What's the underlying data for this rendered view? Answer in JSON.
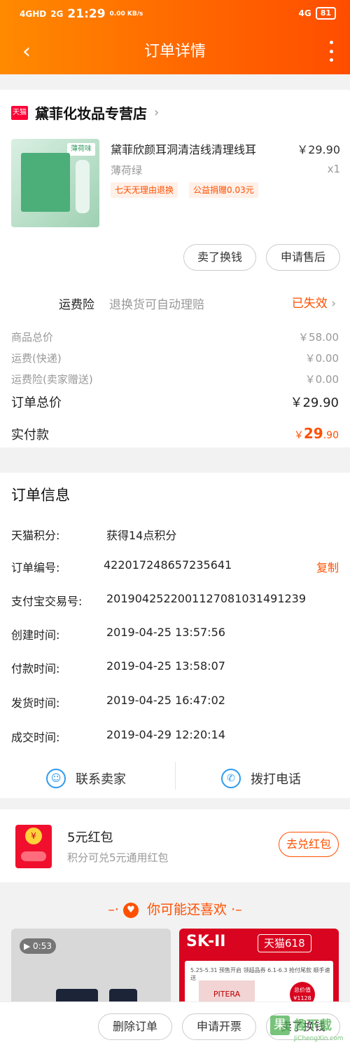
{
  "status_bar": {
    "network1": "4GHD",
    "network2": "2G",
    "time": "21:29",
    "speed": "0.00 KB/s",
    "network3": "4G",
    "battery": "81"
  },
  "nav": {
    "title": "订单详情",
    "back_icon": "chevron-left-icon",
    "more_icon": "more-vertical-icon"
  },
  "shop": {
    "badge": "天猫",
    "name": "黛菲化妆品专营店"
  },
  "product": {
    "thumb_label": "薄荷味",
    "title": "黛菲欣颜耳洞清洁线清理线耳",
    "price": "￥29.90",
    "spec": "薄荷绿",
    "qty": "x1",
    "tags": [
      "七天无理由退换",
      "公益捐赠0.03元"
    ]
  },
  "actions": {
    "sell": "卖了换钱",
    "after_sale": "申请售后"
  },
  "freight": {
    "label": "运费险",
    "desc": "退换货可自动理赔",
    "status": "已失效"
  },
  "costs": [
    {
      "label": "商品总价",
      "value": "￥58.00"
    },
    {
      "label": "运费(快递)",
      "value": "￥0.00"
    },
    {
      "label": "运费险(卖家赠送)",
      "value": "￥0.00"
    }
  ],
  "total": {
    "label": "订单总价",
    "value": "￥29.90"
  },
  "paid": {
    "label": "实付款",
    "currency": "￥",
    "int": "29",
    "dec": ".90"
  },
  "order_info": {
    "title": "订单信息",
    "rows": [
      {
        "label": "天猫积分:",
        "value": "获得14点积分"
      },
      {
        "label": "订单编号:",
        "value": "422017248657235641"
      },
      {
        "label": "支付宝交易号:",
        "value": "2019042522001127081031491239"
      },
      {
        "label": "创建时间:",
        "value": "2019-04-25 13:57:56"
      },
      {
        "label": "付款时间:",
        "value": "2019-04-25 13:58:07"
      },
      {
        "label": "发货时间:",
        "value": "2019-04-25 16:47:02"
      },
      {
        "label": "成交时间:",
        "value": "2019-04-29 12:20:14"
      }
    ],
    "copy": "复制"
  },
  "contact": {
    "seller": "联系卖家",
    "call": "拨打电话"
  },
  "red_packet": {
    "title": "5元红包",
    "subtitle": "积分可兑5元通用红包",
    "button": "去兑红包"
  },
  "recommend": {
    "title": "你可能还喜欢",
    "video_duration": "0:53",
    "brand": "SK-II",
    "promo": "天猫618",
    "promo_line": "5.25-5.31 预售开启 领超品券   6.1-6.3 抢付尾款 顺手速送",
    "product": "PITERA",
    "price_tag": "总价值 ¥1128"
  },
  "bottom_bar": {
    "delete": "删除订单",
    "invoice": "申请开票",
    "sell": "卖了换钱"
  },
  "watermark": {
    "logo": "果",
    "text": "趣下载",
    "url": "JiChengXin.com"
  }
}
